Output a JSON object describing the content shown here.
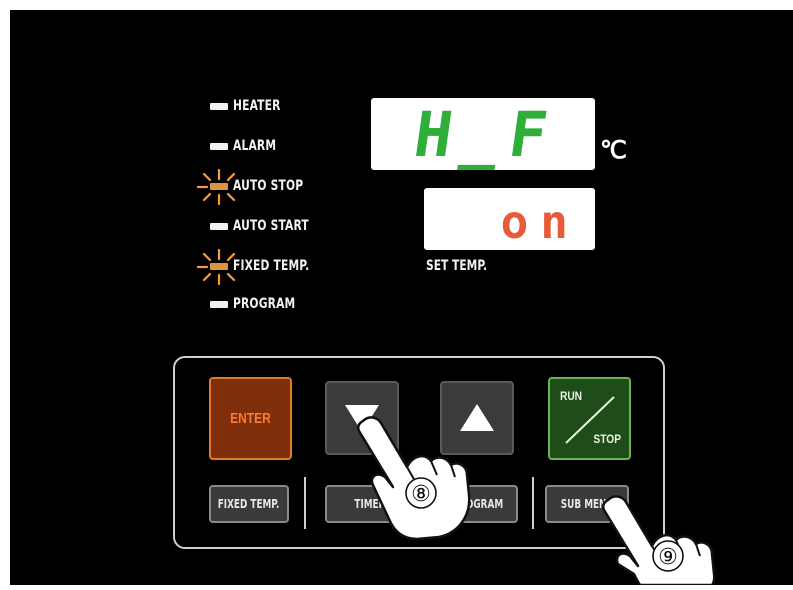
{
  "indicators": [
    {
      "label": "HEATER",
      "lit": false
    },
    {
      "label": "ALARM",
      "lit": false
    },
    {
      "label": "AUTO STOP",
      "lit": true
    },
    {
      "label": "AUTO START",
      "lit": false
    },
    {
      "label": "FIXED TEMP.",
      "lit": true
    },
    {
      "label": "PROGRAM",
      "lit": false
    }
  ],
  "display": {
    "main_value": "H_F",
    "main_color": "#2fae3a",
    "unit": "℃",
    "set_value": "on",
    "set_color": "#e85a3a",
    "set_label": "SET TEMP."
  },
  "keys": {
    "enter": "ENTER",
    "down": "down-arrow",
    "up": "up-arrow",
    "run_top": "RUN",
    "run_bottom": "STOP"
  },
  "soft_keys": {
    "fixed_temp": "FIXED TEMP.",
    "timer": "TIMER",
    "program": "PROGRAM",
    "sub_menu": "SUB MENU"
  },
  "steps": {
    "step_8": "⑧",
    "step_9": "⑨"
  },
  "colors": {
    "panel_bg": "#000000",
    "lit_led": "#d8953e",
    "enter_accent": "#e07b2a",
    "run_accent": "#6fb052"
  }
}
